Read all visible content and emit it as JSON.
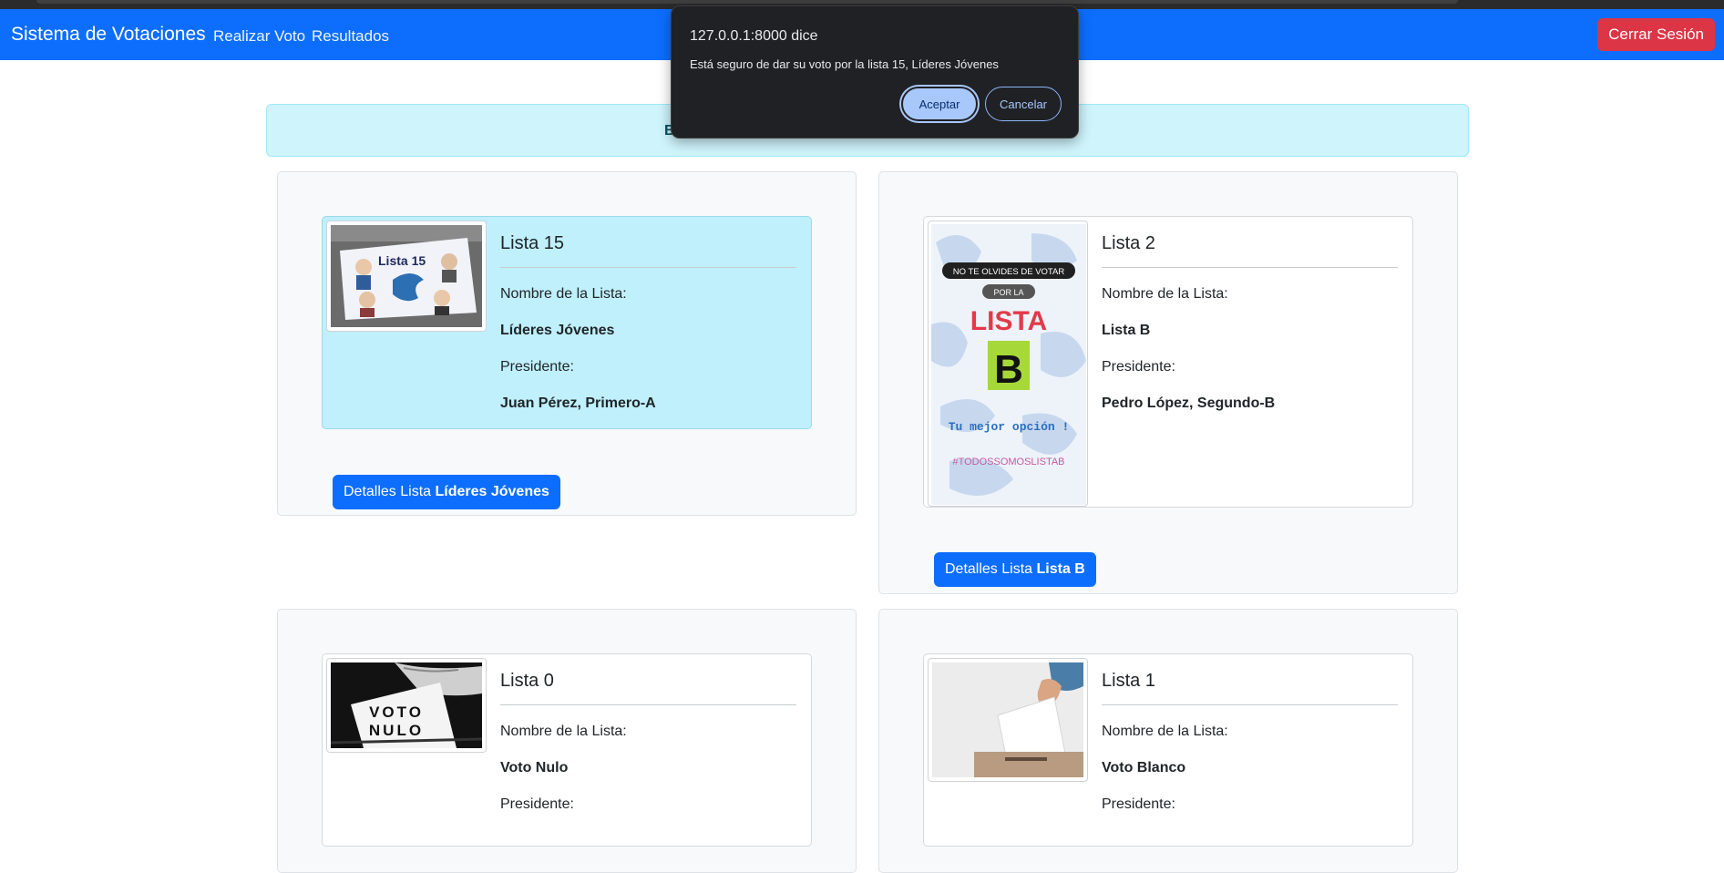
{
  "navbar": {
    "brand": "Sistema de Votaciones",
    "links": [
      "Realizar Voto",
      "Resultados"
    ],
    "logout_label": "Cerrar Sesión"
  },
  "alert": {
    "visible_fragment": "B"
  },
  "dialog": {
    "title": "127.0.0.1:8000 dice",
    "message": "Está seguro de dar su voto por la lista 15, Líderes Jóvenes",
    "ok_label": "Aceptar",
    "cancel_label": "Cancelar"
  },
  "field_labels": {
    "list_name": "Nombre de la Lista:",
    "president": "Presidente:"
  },
  "details_prefix": "Detalles Lista ",
  "lists": [
    {
      "title": "Lista 15",
      "name": "Líderes Jóvenes",
      "president": "Juan Pérez, Primero-A",
      "image_icon": "banner-lista-15-icon",
      "selected": true
    },
    {
      "title": "Lista 2",
      "name": "Lista B",
      "president": "Pedro López, Segundo-B",
      "image_icon": "poster-lista-b-icon",
      "selected": false,
      "poster_text": {
        "line1": "NO TE OLVIDES DE VOTAR",
        "line2": "POR LA",
        "line3": "LISTA",
        "letter": "B",
        "slogan": "Tu mejor opción !",
        "hashtag": "#TODOSSOMOSLISTAB"
      }
    },
    {
      "title": "Lista 0",
      "name": "Voto Nulo",
      "president": "",
      "image_icon": "voto-nulo-icon",
      "selected": false,
      "image_text": {
        "line1": "VOTO",
        "line2": "NULO"
      }
    },
    {
      "title": "Lista 1",
      "name": "Voto Blanco",
      "president": "",
      "image_icon": "ballot-box-icon",
      "selected": false
    }
  ],
  "colors": {
    "primary": "#0d6efd",
    "danger": "#dc3545",
    "info_bg": "#cff4fc",
    "selected_bg": "#bff0fb",
    "dialog_bg": "#202124",
    "dialog_accent": "#a8c7fa"
  }
}
